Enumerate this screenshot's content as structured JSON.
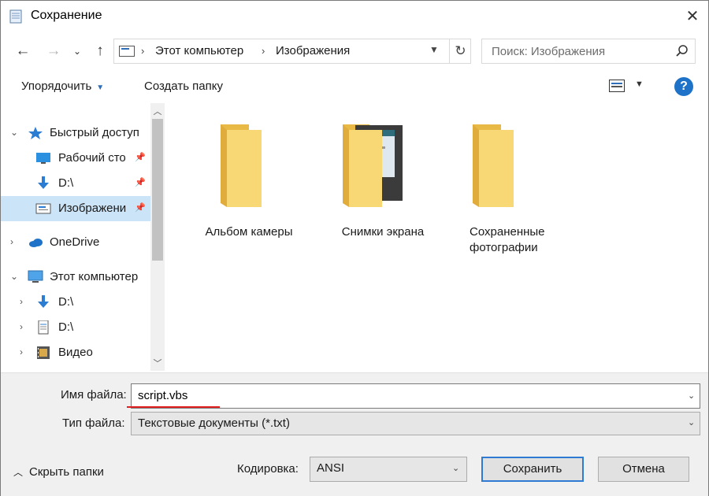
{
  "window": {
    "title": "Сохранение",
    "close_label": "✕"
  },
  "address": {
    "crumbs": [
      "Этот компьютер",
      "Изображения"
    ],
    "search_placeholder": "Поиск: Изображения"
  },
  "toolbar": {
    "organize_label": "Упорядочить",
    "new_folder_label": "Создать папку",
    "help_label": "?"
  },
  "navpane": {
    "items": [
      {
        "label": "Быстрый доступ",
        "icon": "star-icon",
        "chevron": "expanded"
      },
      {
        "label": "Рабочий сто",
        "icon": "desktop-icon",
        "pinned": true
      },
      {
        "label": "D:\\",
        "icon": "download-icon",
        "pinned": true
      },
      {
        "label": "Изображени",
        "icon": "pictures-icon",
        "pinned": true,
        "selected": true
      },
      {
        "label": "OneDrive",
        "icon": "cloud-icon",
        "chevron": "collapsed"
      },
      {
        "label": "Этот компьютер",
        "icon": "computer-icon",
        "chevron": "expanded"
      },
      {
        "label": "D:\\",
        "icon": "download-icon",
        "chevron": "collapsed"
      },
      {
        "label": "D:\\",
        "icon": "document-icon",
        "chevron": "collapsed"
      },
      {
        "label": "Видео",
        "icon": "video-icon",
        "chevron": "collapsed"
      }
    ]
  },
  "content": {
    "folders": [
      {
        "label": "Альбом камеры",
        "icon": "folder-icon"
      },
      {
        "label": "Снимки экрана",
        "icon": "folder-screenshots-icon"
      },
      {
        "label": "Сохраненные фотографии",
        "icon": "folder-icon"
      }
    ]
  },
  "form": {
    "filename_label": "Имя файла:",
    "filename_value": "script.vbs",
    "filetype_label": "Тип файла:",
    "filetype_value": "Текстовые документы (*.txt)",
    "hide_folders_label": "Скрыть папки",
    "encoding_label": "Кодировка:",
    "encoding_value": "ANSI",
    "save_label": "Сохранить",
    "cancel_label": "Отмена"
  },
  "colors": {
    "accent": "#1e73c8",
    "selected_bg": "#cce4f7",
    "folder": "#f8d775",
    "annotation_underline": "#e02020"
  }
}
